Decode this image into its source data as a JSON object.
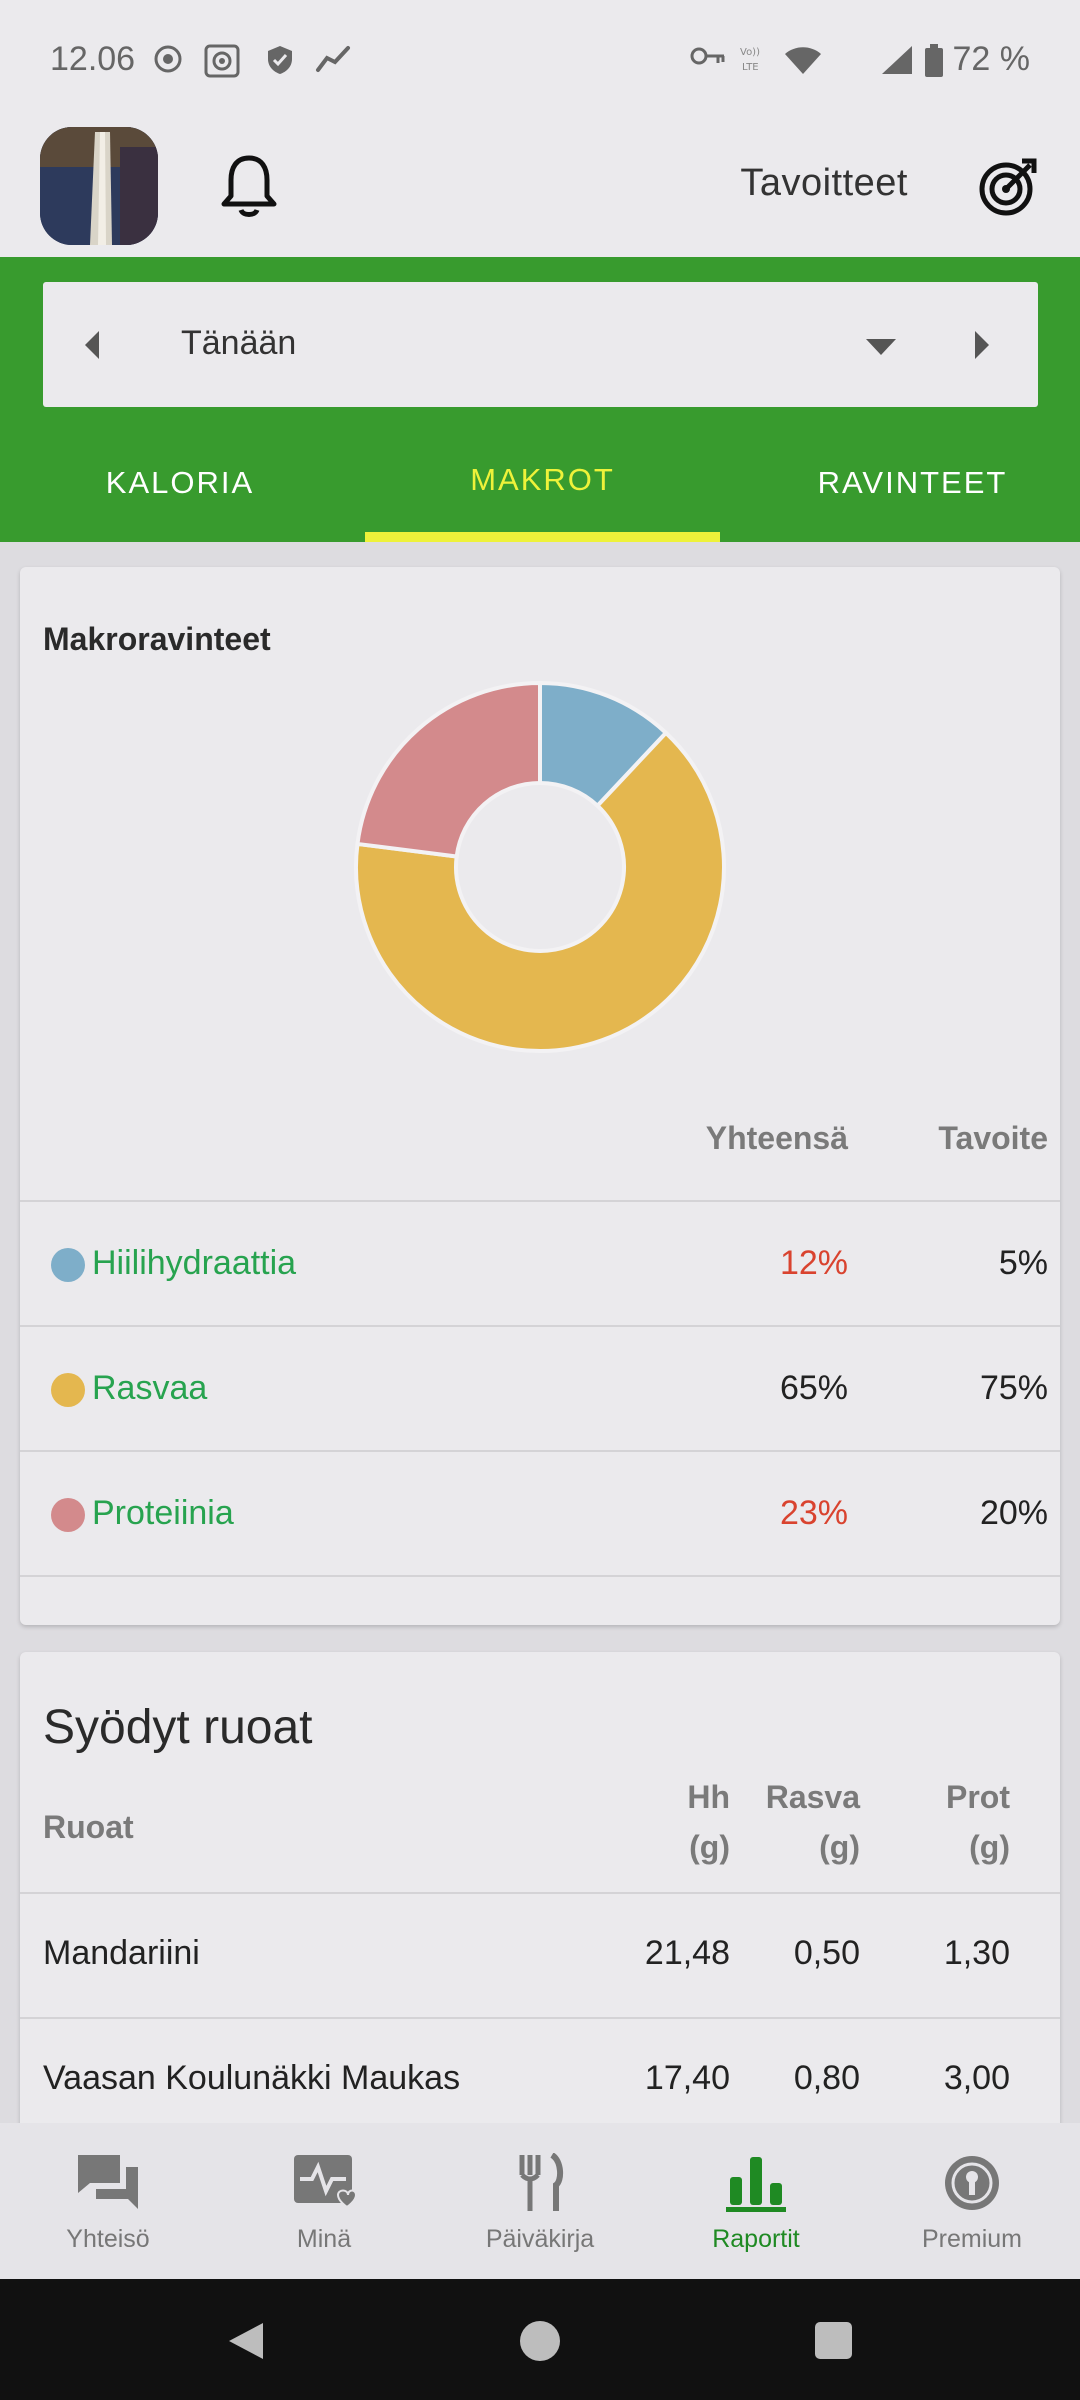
{
  "status_bar": {
    "time": "12.06",
    "battery": "72 %"
  },
  "header": {
    "goals_label": "Tavoitteet"
  },
  "date_selector": {
    "label": "Tänään"
  },
  "tabs": [
    {
      "label": "KALORIA",
      "active": false
    },
    {
      "label": "MAKROT",
      "active": true
    },
    {
      "label": "RAVINTEET",
      "active": false
    }
  ],
  "macros_card": {
    "title": "Makroravinteet",
    "col_total": "Yhteensä",
    "col_goal": "Tavoite",
    "rows": [
      {
        "name": "Hiilihydraattia",
        "total": "12%",
        "goal": "5%",
        "color": "#7eaec9",
        "total_color": "#d9432f"
      },
      {
        "name": "Rasvaa",
        "total": "65%",
        "goal": "75%",
        "color": "#e4b74f",
        "total_color": "#222222"
      },
      {
        "name": "Proteiinia",
        "total": "23%",
        "goal": "20%",
        "color": "#d38a8c",
        "total_color": "#d9432f"
      }
    ]
  },
  "chart_data": {
    "type": "pie",
    "title": "Makroravinteet",
    "categories": [
      "Hiilihydraattia",
      "Rasvaa",
      "Proteiinia"
    ],
    "values": [
      12,
      65,
      23
    ],
    "colors": [
      "#7eaec9",
      "#e4b74f",
      "#d38a8c"
    ],
    "legend": "none"
  },
  "foods_card": {
    "title": "Syödyt ruoat",
    "col_name": "Ruoat",
    "col_hh": "Hh",
    "col_hh_unit": "(g)",
    "col_fat": "Rasva",
    "col_fat_unit": "(g)",
    "col_prot": "Prot",
    "col_prot_unit": "(g)",
    "rows": [
      {
        "name": "Mandariini",
        "hh": "21,48",
        "fat": "0,50",
        "prot": "1,30"
      },
      {
        "name": "Vaasan Koulunäkki Maukas",
        "hh": "17,40",
        "fat": "0,80",
        "prot": "3,00"
      }
    ]
  },
  "bottom_nav": [
    {
      "label": "Yhteisö",
      "icon": "chat-icon",
      "active": false
    },
    {
      "label": "Minä",
      "icon": "heart-pulse-icon",
      "active": false
    },
    {
      "label": "Päiväkirja",
      "icon": "fork-knife-icon",
      "active": false
    },
    {
      "label": "Raportit",
      "icon": "bar-chart-icon",
      "active": true
    },
    {
      "label": "Premium",
      "icon": "premium-badge-icon",
      "active": false
    }
  ]
}
